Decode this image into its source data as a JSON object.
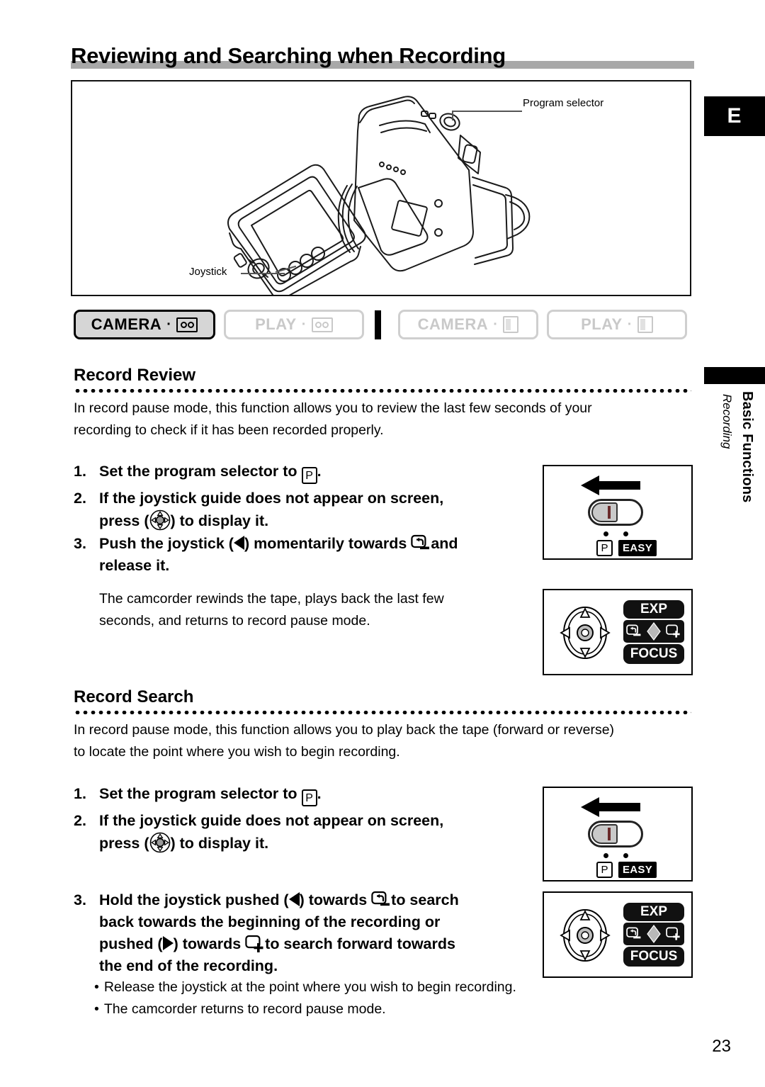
{
  "page": {
    "title": "Reviewing and Searching when Recording",
    "number": "23",
    "lang_badge": "E"
  },
  "margin": {
    "section_bold": "Basic Functions",
    "section_italic": "Recording"
  },
  "illustration": {
    "callout_program_selector": "Program selector",
    "callout_joystick": "Joystick"
  },
  "mode_tabs": [
    {
      "label": "CAMERA",
      "dot": "·",
      "media": "tape",
      "state": "active"
    },
    {
      "label": "PLAY",
      "dot": "·",
      "media": "tape",
      "state": "inactive"
    },
    {
      "label": "CAMERA",
      "dot": "·",
      "media": "card",
      "state": "inactive"
    },
    {
      "label": "PLAY",
      "dot": "·",
      "media": "card",
      "state": "inactive"
    }
  ],
  "record_review": {
    "heading": "Record Review",
    "intro_line1": "In record pause mode, this function allows you to review the last few seconds of your",
    "intro_line2": "recording to check if it has been recorded properly.",
    "steps": [
      {
        "num": "1.",
        "part1": "Set the program selector to",
        "icon": "program-p-icon",
        "part2": "."
      },
      {
        "num": "2.",
        "part1": "If the joystick guide does not appear on screen,",
        "part2": "press (",
        "icon": "joystick-icon",
        "part3": ") to display it."
      },
      {
        "num": "3.",
        "part1": "Push the joystick (",
        "icon_dir": "left-arrow",
        "part2": ") momentarily towards",
        "icon": "record-search-back-icon",
        "part3": "and",
        "part4": "release it."
      }
    ],
    "result_line1": "The camcorder rewinds the tape, plays back the last few",
    "result_line2": "seconds, and returns to record pause mode."
  },
  "record_search": {
    "heading": "Record Search",
    "intro_line1": "In record pause mode, this function allows you to play back the tape (forward or reverse)",
    "intro_line2": "to locate the point where you wish to begin recording.",
    "steps": [
      {
        "num": "1.",
        "part1": "Set the program selector to",
        "icon": "program-p-icon",
        "part2": "."
      },
      {
        "num": "2.",
        "part1": "If the joystick guide does not appear on screen,",
        "part2": "press (",
        "icon": "joystick-icon",
        "part3": ") to display it."
      },
      {
        "num": "3.",
        "part1": "Hold the joystick pushed (",
        "part2": ") towards",
        "part3": "to search",
        "part4": "back towards the beginning of the recording or",
        "part5": "pushed (",
        "part6": ") towards",
        "part7": "to search forward towards",
        "part8": "the end of the recording."
      }
    ],
    "bullets": [
      "Release the joystick at the point where you wish to begin recording.",
      "The camcorder returns to record pause mode."
    ],
    "bullet_mark": "•"
  },
  "selector_panel": {
    "p_label": "P",
    "easy_label": "EASY"
  },
  "joystick_guide": {
    "top_label": "EXP",
    "bottom_label": "FOCUS",
    "left_icon": "record-search-back-icon",
    "right_icon": "record-search-forward-icon"
  },
  "colors": {
    "rule_gray": "#a8a8a8",
    "tab_inactive": "#c9c9c9",
    "panel_black": "#111111",
    "ink": "#000000"
  }
}
